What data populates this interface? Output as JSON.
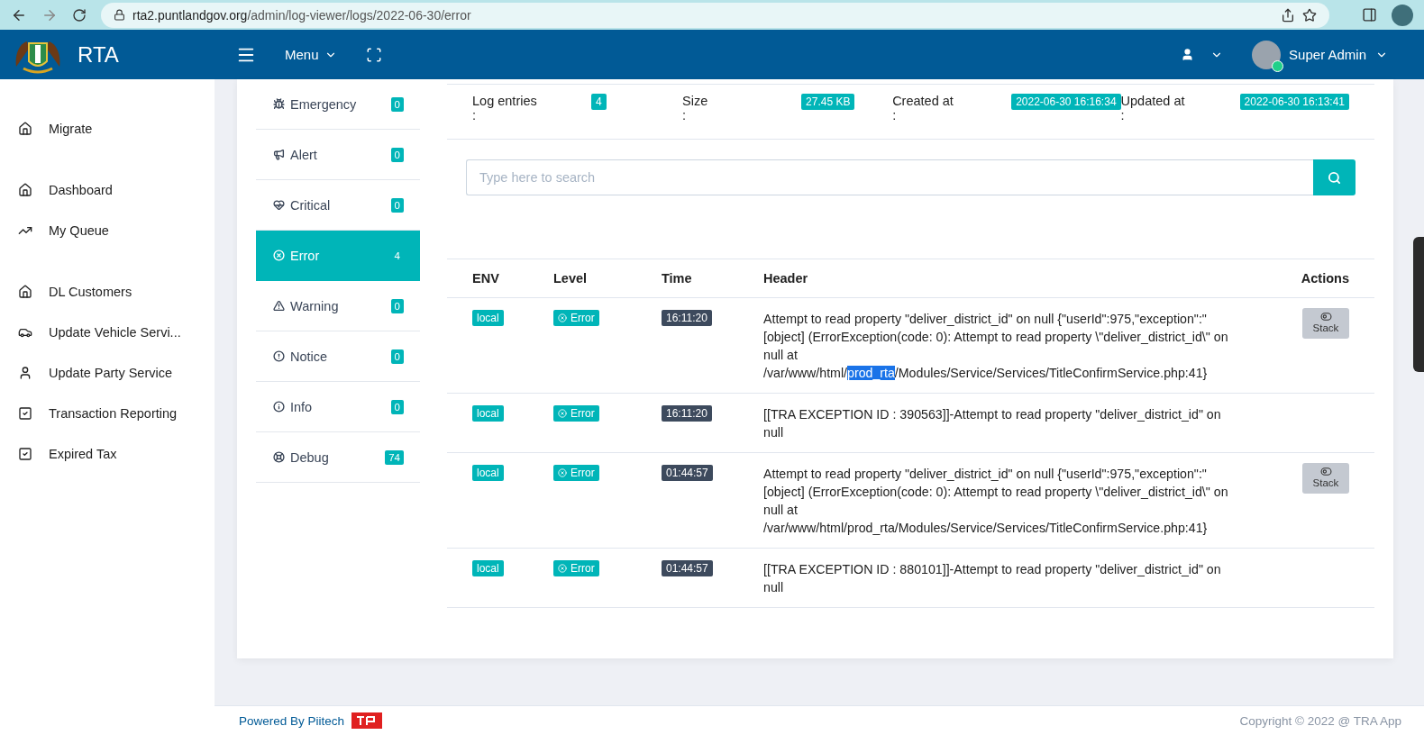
{
  "browser": {
    "url_host": "rta2.puntlandgov.org",
    "url_path": "/admin/log-viewer/logs/2022-06-30/error"
  },
  "topbar": {
    "brand": "RTA",
    "menu_label": "Menu",
    "user_name": "Super Admin",
    "online": true
  },
  "sidebar": {
    "sections": [
      {
        "items": [
          {
            "label": "Migrate"
          }
        ]
      },
      {
        "items": [
          {
            "label": "Dashboard"
          },
          {
            "label": "My Queue"
          }
        ]
      },
      {
        "items": [
          {
            "label": "DL Customers"
          },
          {
            "label": "Update Vehicle Servi..."
          },
          {
            "label": "Update Party Service"
          },
          {
            "label": "Transaction Reporting"
          },
          {
            "label": "Expired Tax"
          }
        ]
      }
    ]
  },
  "levels": [
    {
      "label": "Emergency",
      "count": "0",
      "selected": false
    },
    {
      "label": "Alert",
      "count": "0",
      "selected": false
    },
    {
      "label": "Critical",
      "count": "0",
      "selected": false
    },
    {
      "label": "Error",
      "count": "4",
      "selected": true
    },
    {
      "label": "Warning",
      "count": "0",
      "selected": false
    },
    {
      "label": "Notice",
      "count": "0",
      "selected": false
    },
    {
      "label": "Info",
      "count": "0",
      "selected": false
    },
    {
      "label": "Debug",
      "count": "74",
      "selected": false
    }
  ],
  "stats": [
    {
      "label": "Log entries",
      "separator": ":",
      "value": "4"
    },
    {
      "label": "Size",
      "separator": ":",
      "value": "27.45 KB"
    },
    {
      "label": "Created at",
      "separator": ":",
      "value": "2022-06-30 16:16:34"
    },
    {
      "label": "Updated at",
      "separator": ":",
      "value": "2022-06-30 16:13:41"
    }
  ],
  "search": {
    "placeholder": "Type here to search"
  },
  "table": {
    "columns": [
      "ENV",
      "Level",
      "Time",
      "Header",
      "Actions"
    ],
    "rows": [
      {
        "env": "local",
        "level": "Error",
        "time": "16:11:20",
        "header": [
          {
            "text": "Attempt to read property \"deliver_district_id\" on null {\"userId\":975,\"exception\":\"[object] (ErrorException(code: 0): Attempt to read property \\\"deliver_district_id\\\" on null at /var/www/html/",
            "selected": false
          },
          {
            "text": "prod_rta",
            "selected": true
          },
          {
            "text": "/Modules/Service/Services/TitleConfirmService.php:41}",
            "selected": false
          }
        ],
        "action": "Stack"
      },
      {
        "env": "local",
        "level": "Error",
        "time": "16:11:20",
        "header": [
          {
            "text": "[[TRA EXCEPTION ID : 390563]]-Attempt to read property \"deliver_district_id\" on null",
            "selected": false
          }
        ]
      },
      {
        "env": "local",
        "level": "Error",
        "time": "01:44:57",
        "header": [
          {
            "text": "Attempt to read property \"deliver_district_id\" on null {\"userId\":975,\"exception\":\"[object] (ErrorException(code: 0): Attempt to read property \\\"deliver_district_id\\\" on null at /var/www/html/prod_rta/Modules/Service/Services/TitleConfirmService.php:41}",
            "selected": false
          }
        ],
        "action": "Stack"
      },
      {
        "env": "local",
        "level": "Error",
        "time": "01:44:57",
        "header": [
          {
            "text": "[[TRA EXCEPTION ID : 880101]]-Attempt to read property \"deliver_district_id\" on null",
            "selected": false
          }
        ]
      }
    ]
  },
  "footer": {
    "powered": "Powered By Piitech",
    "copyright": "Copyright © 2022 @ TRA App"
  }
}
